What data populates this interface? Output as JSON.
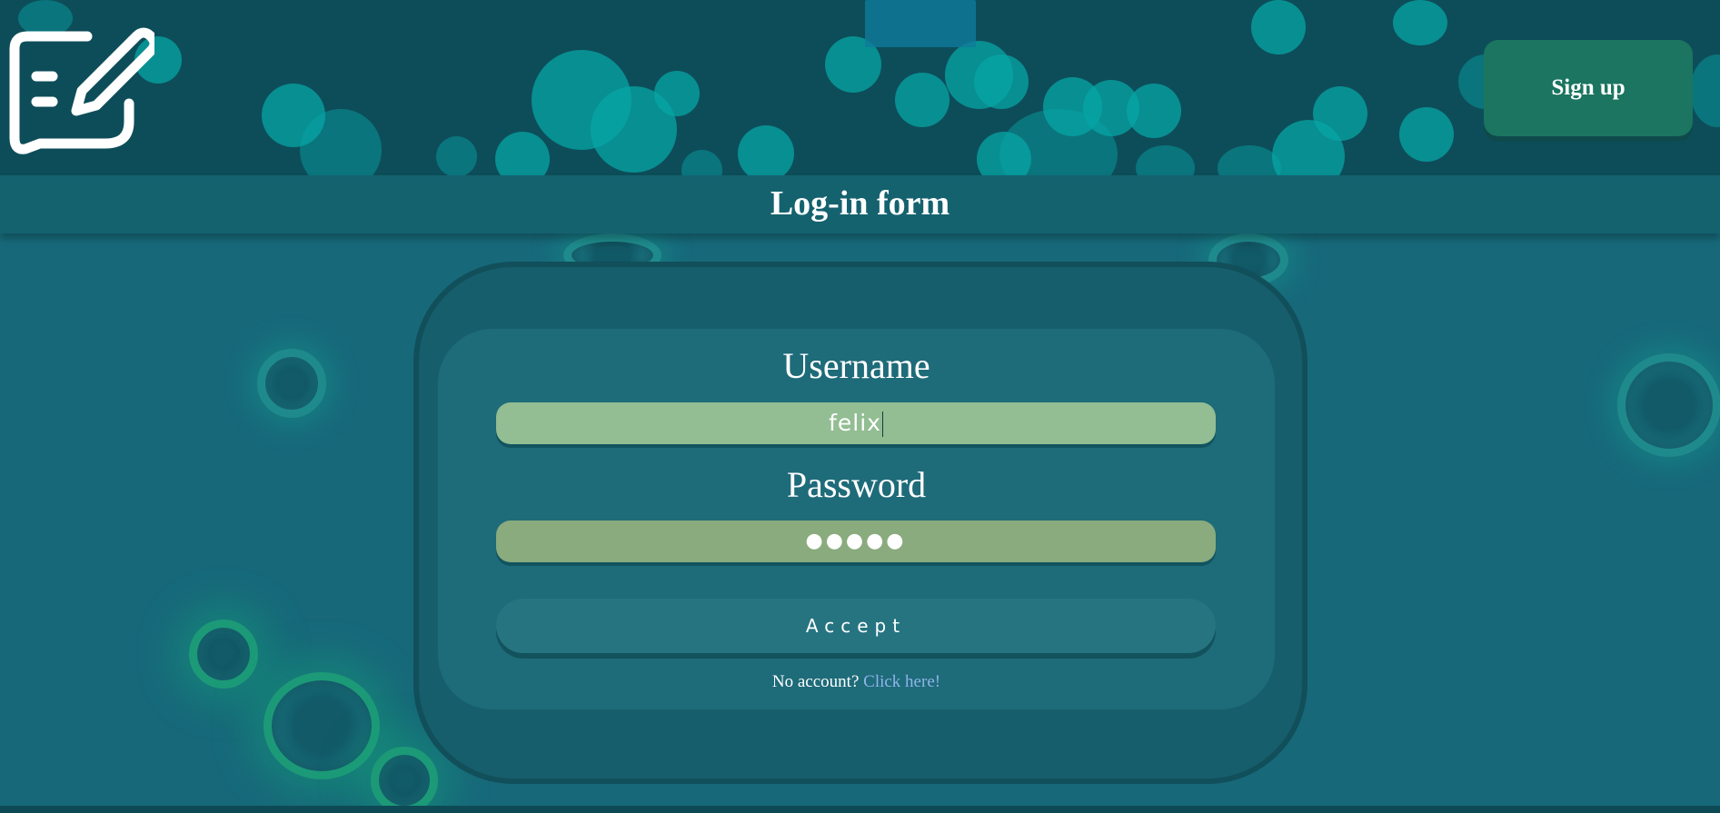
{
  "header": {
    "logo_icon": "edit-message-icon",
    "signup_label": "Sign up"
  },
  "title": "Log-in form",
  "form": {
    "username_label": "Username",
    "username_value": "felix",
    "password_label": "Password",
    "password_value": "●●●●●",
    "accept_label": "Accept",
    "no_account_text": "No account?",
    "click_here_label": "Click here!"
  },
  "colors": {
    "header_bg": "#0d4d59",
    "page_bg": "#17697a",
    "signup_bg": "#1b7560",
    "username_bg": "#93bd92",
    "password_bg": "#89ab7d",
    "link": "#8fb4ea"
  }
}
